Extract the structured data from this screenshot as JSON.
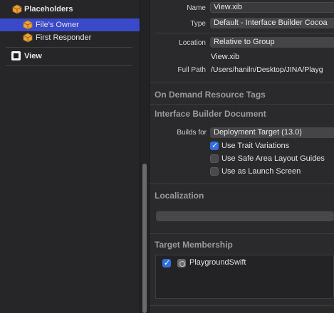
{
  "outline": {
    "placeholders_label": "Placeholders",
    "files_owner_label": "File's Owner",
    "first_responder_label": "First Responder",
    "view_label": "View"
  },
  "identity": {
    "name_label": "Name",
    "name_value": "View.xib",
    "type_label": "Type",
    "type_value": "Default - Interface Builder Cocoa",
    "location_label": "Location",
    "location_value": "Relative to Group",
    "location_file": "View.xib",
    "full_path_label": "Full Path",
    "full_path_value": "/Users/haniln/Desktop/JINA/Playg"
  },
  "on_demand": {
    "title": "On Demand Resource Tags"
  },
  "ib_document": {
    "title": "Interface Builder Document",
    "builds_for_label": "Builds for",
    "builds_for_value": "Deployment Target (13.0)",
    "options": [
      {
        "label": "Use Trait Variations",
        "checked": true
      },
      {
        "label": "Use Safe Area Layout Guides",
        "checked": false
      },
      {
        "label": "Use as Launch Screen",
        "checked": false
      }
    ]
  },
  "localization": {
    "title": "Localization"
  },
  "target_membership": {
    "title": "Target Membership",
    "targets": [
      {
        "name": "PlaygroundSwift",
        "checked": true
      }
    ]
  },
  "colors": {
    "selection": "#3a49c9",
    "checkbox_on": "#2f6fe0",
    "cube_orange": "#e8a33a"
  },
  "icons": {
    "placeholders": "cube-icon",
    "files_owner": "cube-icon",
    "first_responder": "cube-icon",
    "view": "view-icon",
    "target": "app-target-icon"
  }
}
